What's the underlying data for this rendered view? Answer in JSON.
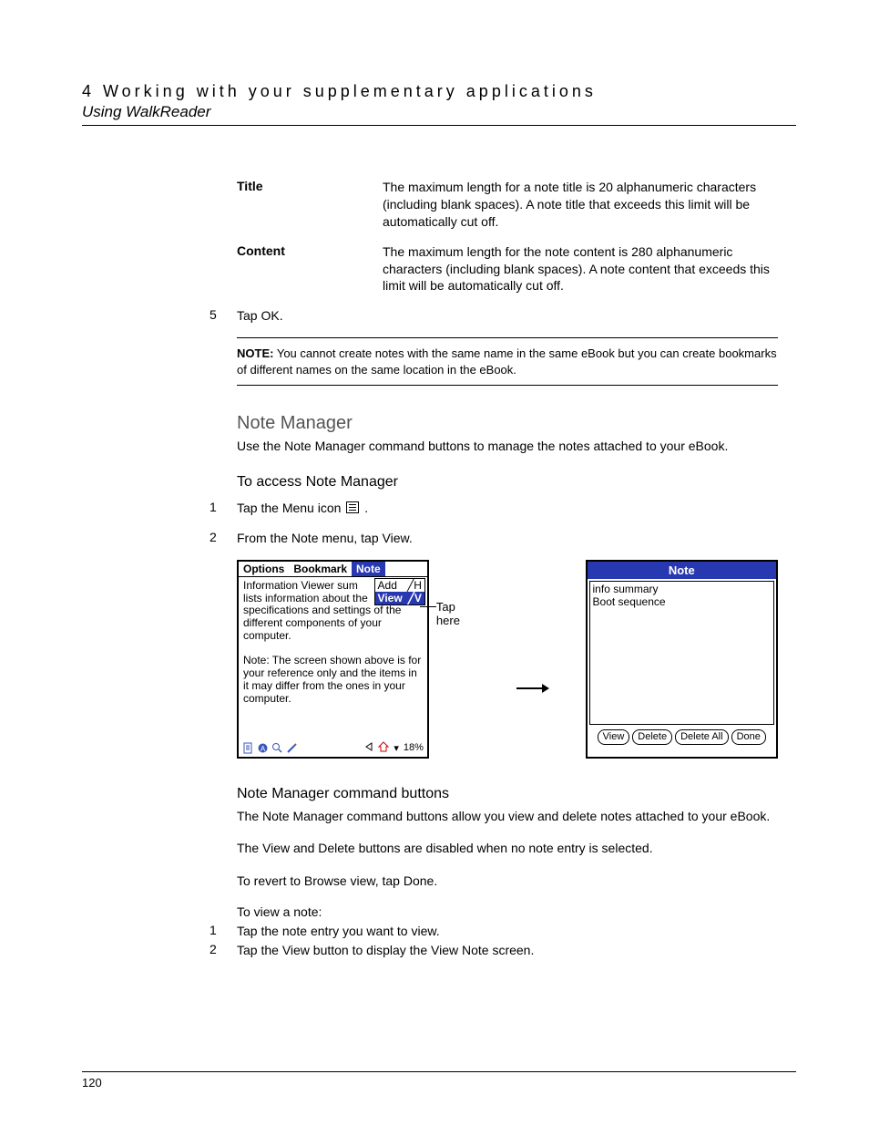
{
  "header": {
    "chapter": "4 Working with your supplementary applications",
    "section": "Using WalkReader"
  },
  "defs": {
    "title_term": "Title",
    "title_desc": "The maximum length for a note title is 20 alphanumeric characters (including blank spaces). A note title that exceeds this limit will be automatically cut off.",
    "content_term": "Content",
    "content_desc": "The maximum length for the note content is 280 alphanumeric characters (including blank spaces). A note content that exceeds this limit will be automatically cut off."
  },
  "step5": {
    "num": "5",
    "text": "Tap OK."
  },
  "note_box": {
    "label": "NOTE:",
    "text": "You cannot create notes with the same name in the same eBook but you can create bookmarks of different names on the same location in the eBook."
  },
  "h2": "Note Manager",
  "intro": "Use the Note Manager command buttons to manage the notes attached to your eBook.",
  "h3_access": "To access Note Manager",
  "access_steps": {
    "s1_num": "1",
    "s1_text_a": "Tap the Menu icon ",
    "s1_text_b": ".",
    "s2_num": "2",
    "s2_text": "From the Note menu, tap View."
  },
  "pda1": {
    "menu": {
      "options": "Options",
      "bookmark": "Bookmark",
      "note": "Note"
    },
    "dd": {
      "add": "Add",
      "add_sc": "╱H",
      "view": "View",
      "view_sc": "╱V"
    },
    "body_line1": "Information Viewer sum",
    "body_rest": "lists information about the specifications and settings of the different components of your computer.",
    "body_note": "Note: The screen shown above is for your reference only and the items in it may differ from the ones in your computer.",
    "zoom": "18%"
  },
  "tap_here": "Tap here",
  "pda2": {
    "title": "Note",
    "item1": "info summary",
    "item2": "Boot sequence",
    "btn_view": "View",
    "btn_delete": "Delete",
    "btn_delete_all": "Delete All",
    "btn_done": "Done"
  },
  "h3_cmd": "Note Manager command buttons",
  "cmd_p1": "The Note Manager command buttons allow you view and delete notes attached to your eBook.",
  "cmd_p2": "The View and Delete buttons are disabled when no note entry is selected.",
  "cmd_p3": "To revert to Browse view, tap Done.",
  "h4_view": "To view a note:",
  "view_steps": {
    "s1_num": "1",
    "s1_text": "Tap the note entry you want to view.",
    "s2_num": "2",
    "s2_text": "Tap the View button to display the View Note screen."
  },
  "page_number": "120"
}
